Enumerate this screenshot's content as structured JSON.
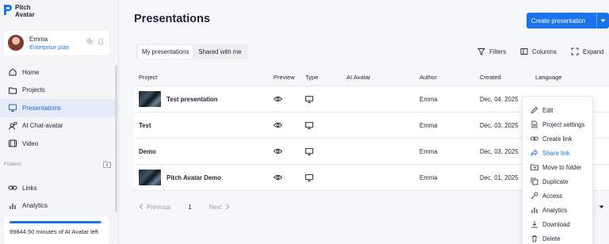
{
  "brand": {
    "line1": "Pitch",
    "line2": "Avatar"
  },
  "user": {
    "name": "Emma",
    "plan": "Enterprise plan"
  },
  "nav": {
    "items": [
      {
        "label": "Home",
        "icon": "home-icon"
      },
      {
        "label": "Projects",
        "icon": "folder-icon"
      },
      {
        "label": "Presentations",
        "icon": "monitor-icon",
        "active": true
      },
      {
        "label": "AI Chat-avatar",
        "icon": "chat-avatar-icon"
      },
      {
        "label": "Video",
        "icon": "video-icon"
      }
    ],
    "folders_label": "Folders",
    "items2": [
      {
        "label": "Links",
        "icon": "link-icon"
      },
      {
        "label": "Analytics",
        "icon": "analytics-icon"
      }
    ]
  },
  "minutes": {
    "text": "99844.50 minutes of AI Avatar left",
    "progress": 0.97
  },
  "page": {
    "title": "Presentations",
    "create_label": "Create presentation"
  },
  "tabs": [
    {
      "label": "My presentations",
      "active": true
    },
    {
      "label": "Shared with me",
      "active": false
    }
  ],
  "toolbar": {
    "filters": "Filters",
    "columns": "Columns",
    "expand": "Expand"
  },
  "table": {
    "headers": {
      "project": "Project",
      "preview": "Preview",
      "type": "Type",
      "avatar": "AI Avatar",
      "author": "Author",
      "created": "Created",
      "language": "Language"
    },
    "rows": [
      {
        "project": "Test presentation",
        "author": "Emma",
        "created": "Dec, 04, 2025",
        "thumb": true
      },
      {
        "project": "Test",
        "author": "Emma",
        "created": "Dec, 03, 2025",
        "thumb": false
      },
      {
        "project": "Demo",
        "author": "Emma",
        "created": "Dec, 03, 2025",
        "thumb": false
      },
      {
        "project": "Pitch Avatar Demo",
        "author": "Emma",
        "created": "Dec, 01, 2025",
        "thumb": true
      }
    ]
  },
  "pagination": {
    "previous": "Previous",
    "page": "1",
    "next": "Next"
  },
  "menu": {
    "items": [
      {
        "label": "Edit",
        "icon": "pencil-icon"
      },
      {
        "label": "Project settings",
        "icon": "settings-doc-icon"
      },
      {
        "label": "Create link",
        "icon": "link-icon"
      },
      {
        "label": "Share link",
        "icon": "share-icon",
        "highlight": true
      },
      {
        "label": "Move to folder",
        "icon": "move-folder-icon"
      },
      {
        "label": "Duplicate",
        "icon": "duplicate-icon"
      },
      {
        "label": "Access",
        "icon": "key-icon"
      },
      {
        "label": "Analytics",
        "icon": "analytics-icon"
      },
      {
        "label": "Download",
        "icon": "download-icon"
      },
      {
        "label": "Delete",
        "icon": "trash-icon"
      }
    ]
  },
  "colors": {
    "accent": "#1a73e8",
    "active_nav_bg": "#e5ecf7"
  }
}
